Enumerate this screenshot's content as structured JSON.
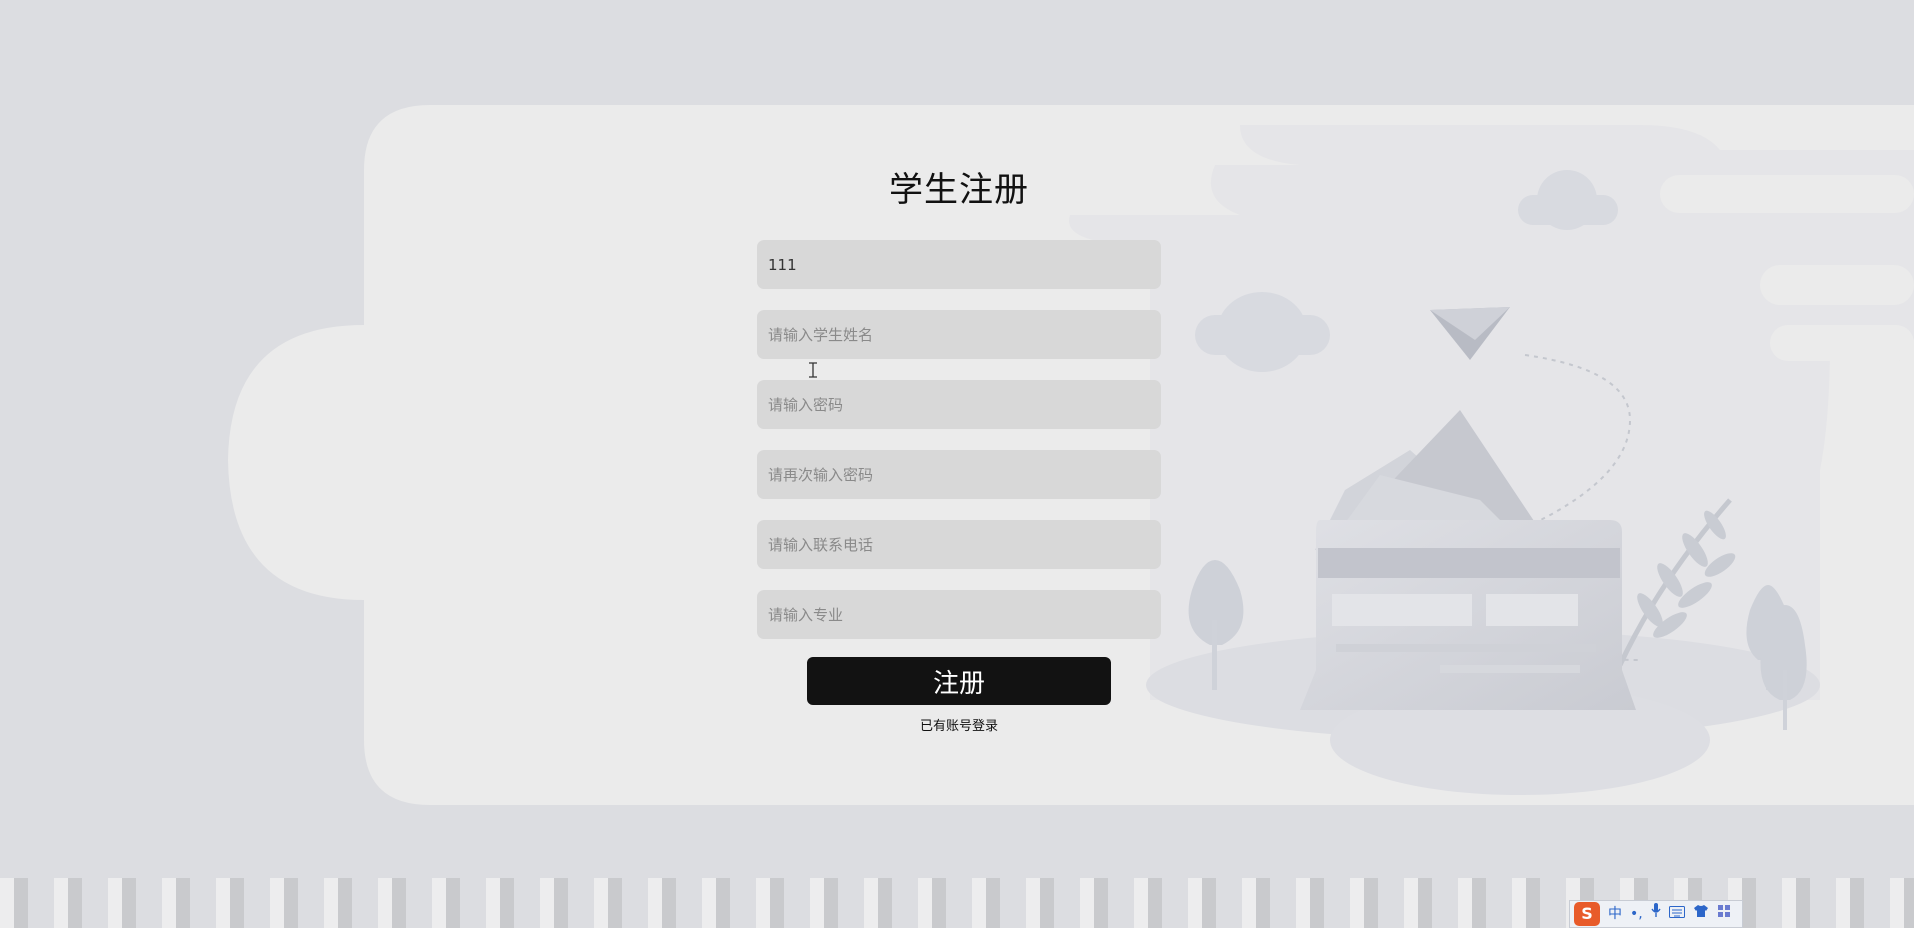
{
  "form": {
    "title": "学生注册",
    "fields": [
      {
        "name": "username-input",
        "value": "111",
        "placeholder": ""
      },
      {
        "name": "student-name-input",
        "value": "",
        "placeholder": "请输入学生姓名"
      },
      {
        "name": "password-input",
        "value": "",
        "placeholder": "请输入密码"
      },
      {
        "name": "confirm-password-input",
        "value": "",
        "placeholder": "请再次输入密码"
      },
      {
        "name": "phone-input",
        "value": "",
        "placeholder": "请输入联系电话"
      },
      {
        "name": "major-input",
        "value": "",
        "placeholder": "请输入专业"
      }
    ],
    "submit_label": "注册",
    "login_link": "已有账号登录"
  },
  "ime": {
    "logo": "S",
    "items": [
      "中",
      "•,",
      "🎤",
      "⌨",
      "👕",
      "▦"
    ]
  },
  "colors": {
    "background": "#dcdde1",
    "card": "#ebebeb",
    "input": "#d8d8d8",
    "button": "#121212",
    "ime_logo": "#e85b2a"
  },
  "icons": [
    "paper-plane-icon",
    "text-cursor-icon",
    "keyboard-icon",
    "microphone-icon",
    "shirt-icon",
    "grid-icon"
  ]
}
